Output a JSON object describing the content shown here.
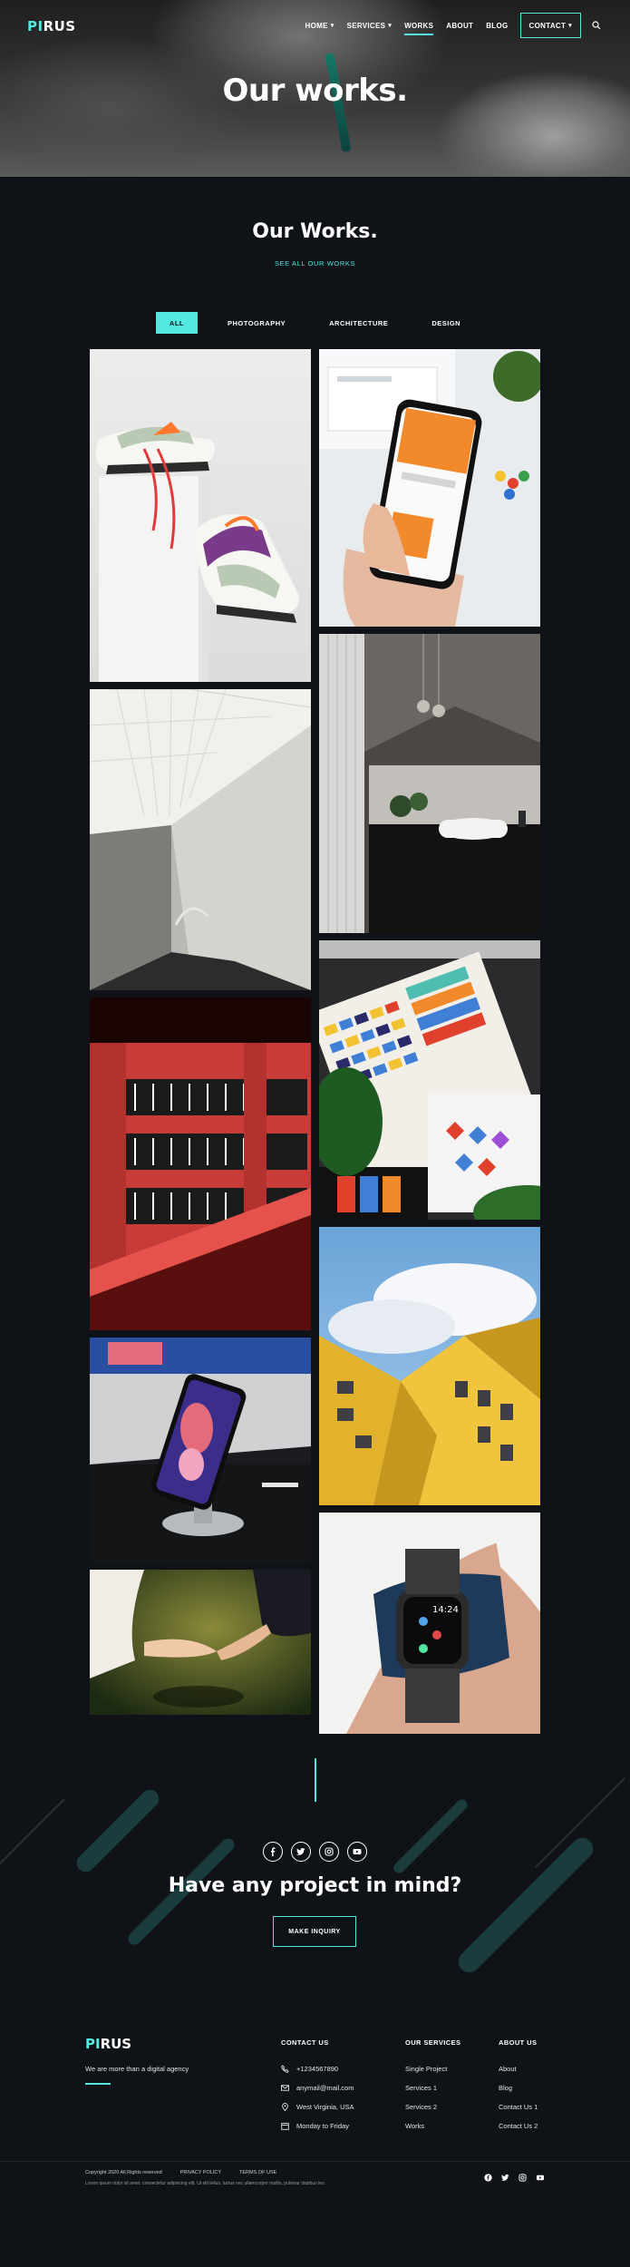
{
  "brand": {
    "logo_mark": "PI",
    "logo_text": "RUS",
    "accent": "#52e8e0"
  },
  "nav": {
    "items": [
      {
        "label": "HOME",
        "caret": true
      },
      {
        "label": "SERVICES",
        "caret": true
      },
      {
        "label": "WORKS",
        "active": true
      },
      {
        "label": "ABOUT"
      },
      {
        "label": "BLOG"
      }
    ],
    "contact_label": "CONTACT"
  },
  "hero": {
    "title": "Our works."
  },
  "works": {
    "title": "Our Works.",
    "link": "SEE ALL OUR WORKS",
    "filters": [
      {
        "label": "ALL",
        "active": true
      },
      {
        "label": "PHOTOGRAPHY"
      },
      {
        "label": "ARCHITECTURE"
      },
      {
        "label": "DESIGN"
      }
    ],
    "tiles": [
      {
        "name": "tile-sneakers"
      },
      {
        "name": "tile-phone-app"
      },
      {
        "name": "tile-hallway"
      },
      {
        "name": "tile-bathroom"
      },
      {
        "name": "tile-red-building"
      },
      {
        "name": "tile-color-swatches"
      },
      {
        "name": "tile-cube-houses"
      },
      {
        "name": "tile-phone-stand"
      },
      {
        "name": "tile-smartwatch",
        "watch_time": "14:24"
      },
      {
        "name": "tile-couple-hands"
      }
    ]
  },
  "cta": {
    "title": "Have any project in mind?",
    "button": "MAKE INQUIRY",
    "socials": [
      "facebook-icon",
      "twitter-icon",
      "instagram-icon",
      "youtube-icon"
    ]
  },
  "footer": {
    "logo_mark": "PI",
    "logo_text": "RUS",
    "tagline": "We are more than a digital agency",
    "contact": {
      "heading": "CONTACT US",
      "phone": "+1234567890",
      "email": "anymail@mail.com",
      "address": "West Virginia, USA",
      "hours": "Monday to Friday"
    },
    "services": {
      "heading": "OUR SERVICES",
      "items": [
        "Single Project",
        "Services 1",
        "Services 2",
        "Works"
      ]
    },
    "about": {
      "heading": "ABOUT US",
      "items": [
        "About",
        "Blog",
        "Contact Us 1",
        "Contact Us 2"
      ]
    },
    "copyright": "Copyright 2020 All Rights reserved",
    "privacy": "PRIVACY POLICY",
    "terms": "TERMS OF USE",
    "lorem": "Lorem ipsum dolor sit amet, consectetur adipiscing elit. Ut elit tellus, luctus nec ullamcorper mattis, pulvinar dapibus leo.",
    "socials": [
      "facebook-icon",
      "twitter-icon",
      "instagram-icon",
      "youtube-icon"
    ]
  }
}
